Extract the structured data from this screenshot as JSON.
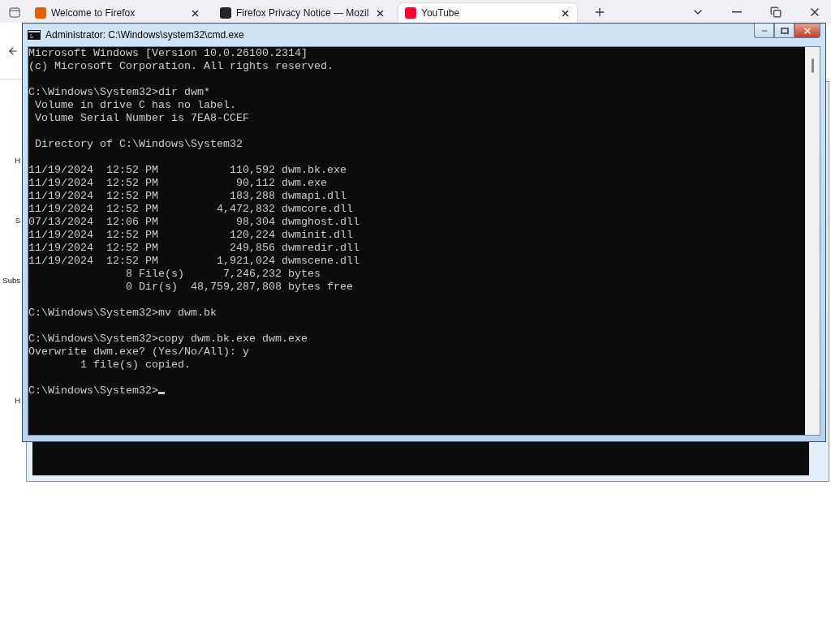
{
  "browser": {
    "tabs": [
      {
        "title": "Welcome to Firefox",
        "selected": false
      },
      {
        "title": "Firefox Privacy Notice — Mozil",
        "selected": false
      },
      {
        "title": "YouTube",
        "selected": true
      }
    ],
    "page_text": [
      "H",
      "S",
      "Subs",
      "H"
    ]
  },
  "console_window": {
    "title": "Administrator: C:\\Windows\\system32\\cmd.exe",
    "blocks": [
      [
        "Microsoft Windows [Version 10.0.26100.2314]",
        "(c) Microsoft Corporation. All rights reserved."
      ],
      [
        "C:\\Windows\\System32>dir dwm*",
        " Volume in drive C has no label.",
        " Volume Serial Number is 7EA8-CCEF"
      ],
      [
        " Directory of C:\\Windows\\System32"
      ],
      [
        "11/19/2024  12:52 PM           110,592 dwm.bk.exe",
        "11/19/2024  12:52 PM            90,112 dwm.exe",
        "11/19/2024  12:52 PM           183,288 dwmapi.dll",
        "11/19/2024  12:52 PM         4,472,832 dwmcore.dll",
        "07/13/2024  12:06 PM            98,304 dwmghost.dll",
        "11/19/2024  12:52 PM           120,224 dwminit.dll",
        "11/19/2024  12:52 PM           249,856 dwmredir.dll",
        "11/19/2024  12:52 PM         1,921,024 dwmscene.dll",
        "               8 File(s)      7,246,232 bytes",
        "               0 Dir(s)  48,759,287,808 bytes free"
      ],
      [
        "C:\\Windows\\System32>mv dwm.bk"
      ],
      [
        "C:\\Windows\\System32>copy dwm.bk.exe dwm.exe",
        "Overwrite dwm.exe? (Yes/No/All): y",
        "        1 file(s) copied."
      ],
      [
        "C:\\Windows\\System32>"
      ]
    ]
  }
}
